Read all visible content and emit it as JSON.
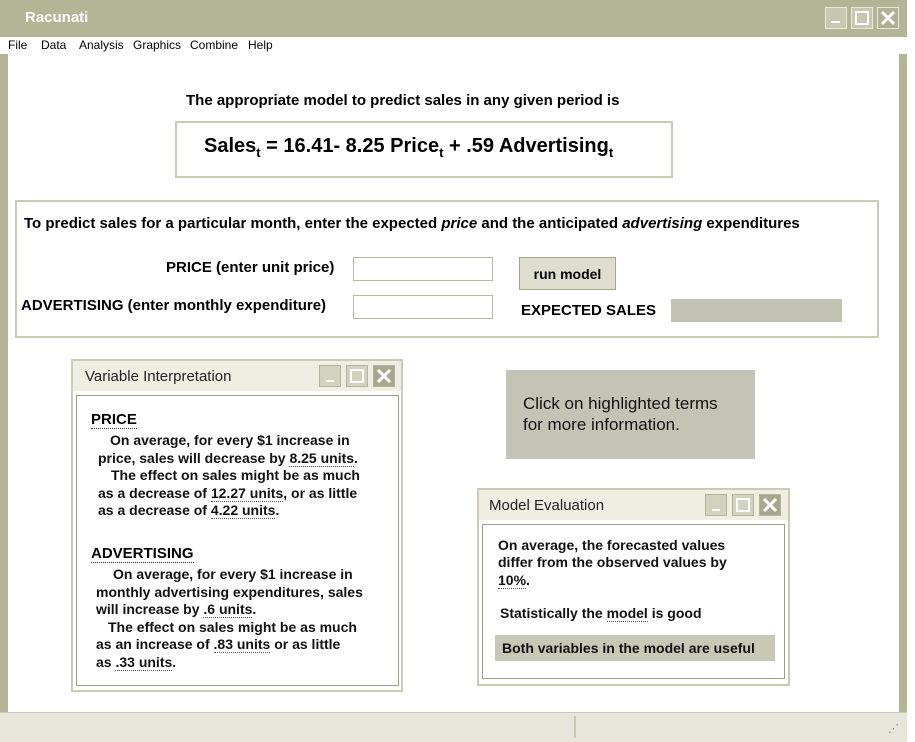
{
  "window": {
    "title": "Racunati"
  },
  "menu": [
    "File",
    "Data",
    "Analysis",
    "Graphics",
    "Combine",
    "Help"
  ],
  "model": {
    "intro": "The appropriate model to predict sales in any given period is",
    "equation": {
      "sales": "Sales",
      "sub": "t",
      "eq_intercept": " =  16.41- 8.25 Price",
      "plus_adv": " + .59 Advertising"
    }
  },
  "predict": {
    "instr_1": "To predict sales for a particular month, enter the expected ",
    "instr_price": "price",
    "instr_2": "  and the anticipated ",
    "instr_adv": "advertising",
    "instr_3": " expenditures",
    "price_label": "PRICE (enter unit price)",
    "adv_label": "ADVERTISING (enter monthly expenditure)",
    "price_value": "",
    "adv_value": "",
    "run_button": "run model",
    "expected_label": "EXPECTED SALES",
    "expected_value": ""
  },
  "variable_window": {
    "title": "Variable Interpretation",
    "price": {
      "heading": "PRICE",
      "l1": "On average, for every $1 increase in",
      "l2a": "price, sales will decrease by ",
      "l2h": "8.25 units",
      "l2b": ".",
      "l3": "The effect on sales might be as much",
      "l4a": "as a decrease of ",
      "l4h": "12.27 units",
      "l4b": ", or as little",
      "l5a": "as a decrease of ",
      "l5h": "4.22 units",
      "l5b": "."
    },
    "advertising": {
      "heading": "ADVERTISING",
      "l1": "On average, for every $1 increase in",
      "l2": "monthly advertising expenditures, sales",
      "l3a": "will increase by ",
      "l3h": ".6 units",
      "l3b": ".",
      "l4": "The effect on sales might be as much",
      "l5a": "as an increase of ",
      "l5h": ".83 units",
      "l5b": " or as little",
      "l6a": "as ",
      "l6h": ".33 units",
      "l6b": "."
    }
  },
  "hint": {
    "l1": "Click on highlighted terms",
    "l2": "for more information."
  },
  "model_eval_window": {
    "title": "Model Evaluation",
    "l1": "On average, the forecasted values",
    "l2": "differ from the observed values by",
    "l3h": "10%",
    "l3b": ".",
    "stat_a": "Statistically the ",
    "stat_h": "model",
    "stat_b": " is good",
    "useful": "Both variables in the model are useful"
  },
  "colors": {
    "chrome": "#b4b497",
    "highlight_box": "#c4c4b6",
    "field": "#c2c2b3"
  },
  "icons": [
    "minimize-icon",
    "maximize-icon",
    "close-icon"
  ]
}
